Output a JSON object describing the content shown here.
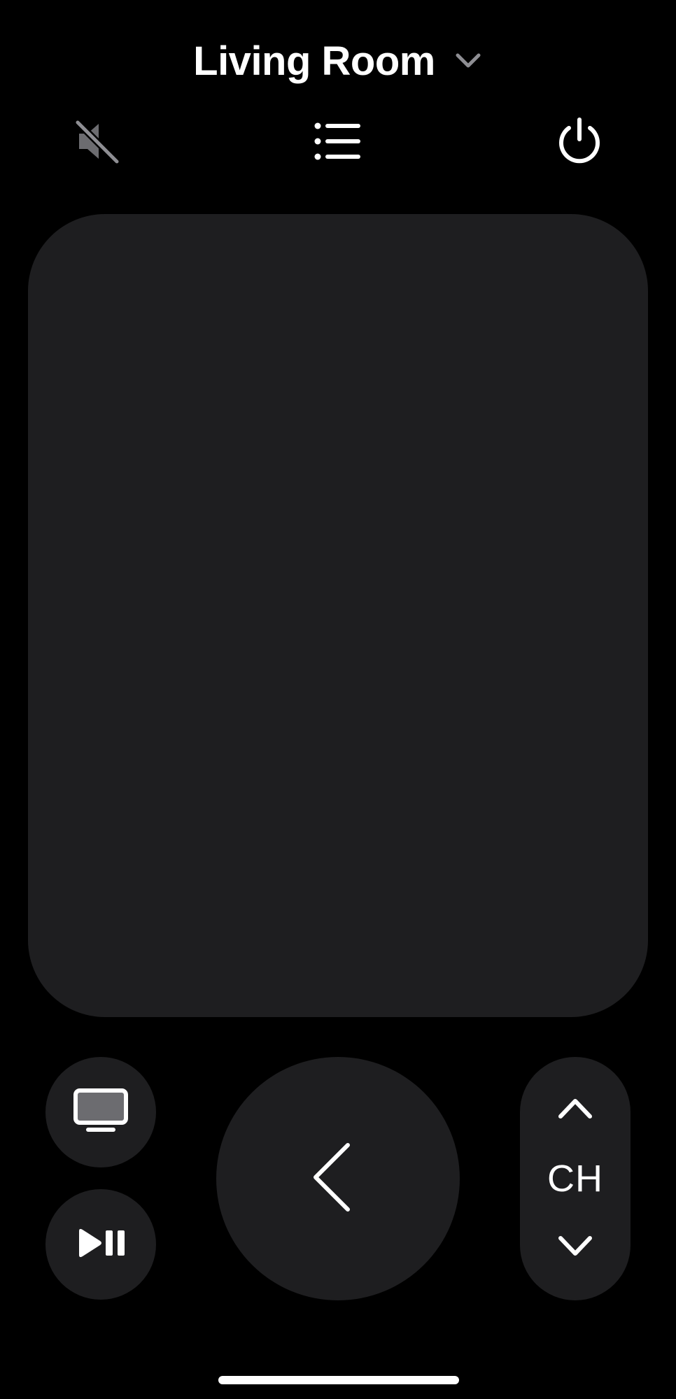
{
  "header": {
    "device_name": "Living Room"
  },
  "controls": {
    "mute_icon": "speaker-slash-icon",
    "list_icon": "list-bullet-icon",
    "power_icon": "power-icon",
    "tv_icon": "tv-icon",
    "play_pause_icon": "play-pause-icon",
    "back_icon": "chevron-left-icon",
    "channel_label": "CH"
  },
  "colors": {
    "background": "#000000",
    "button_fill": "#1e1e20",
    "icon": "#ffffff",
    "icon_muted": "#8e8e93",
    "chevron_muted": "#8e8e93"
  }
}
